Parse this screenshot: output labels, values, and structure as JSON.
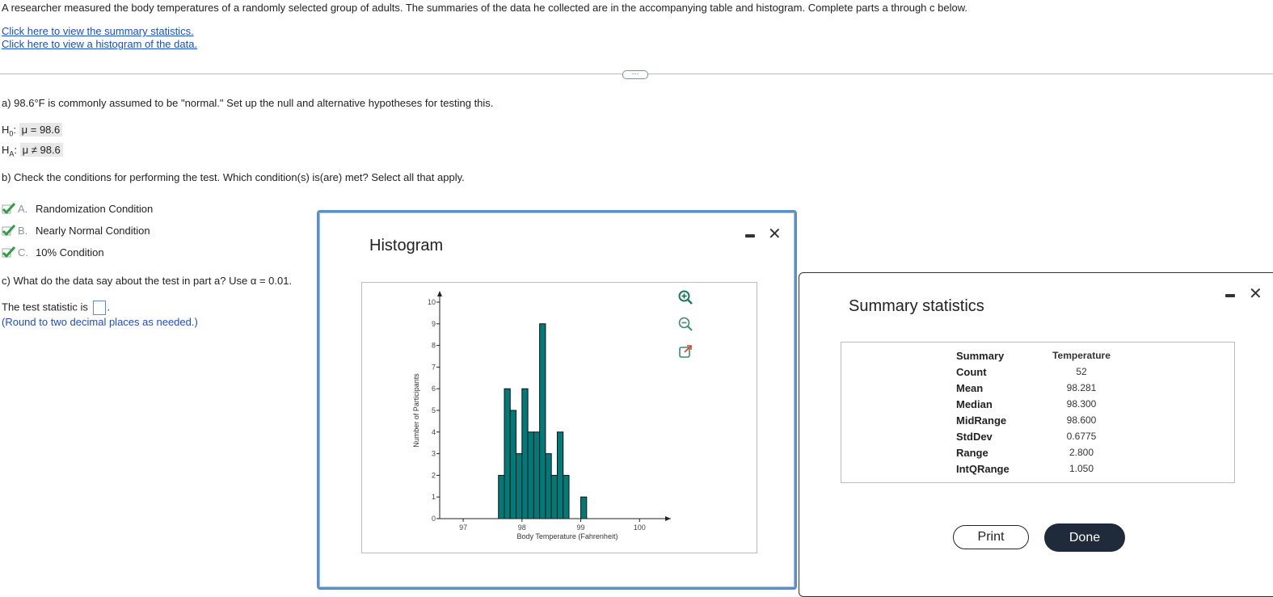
{
  "intro": "A researcher measured the body temperatures of a randomly selected group of adults. The summaries of the data he collected are in the accompanying table and histogram. Complete parts a through c below.",
  "links": {
    "summary": "Click here to view the summary statistics.",
    "histogram": "Click here to view a histogram of the data."
  },
  "ellipsis": "···",
  "part_a": {
    "prompt": "a) 98.6°F is commonly assumed to be \"normal.\" Set up the null and alternative hypotheses for testing this.",
    "h0_label": "H",
    "h0_sub": "0",
    "h0_value": "μ = 98.6",
    "ha_label": "H",
    "ha_sub": "A",
    "ha_value": "μ ≠ 98.6"
  },
  "part_b": {
    "prompt": "b) Check the conditions for performing the test. Which condition(s) is(are) met? Select all that apply.",
    "options": [
      {
        "letter": "A.",
        "label": "Randomization Condition",
        "checked": true
      },
      {
        "letter": "B.",
        "label": "Nearly Normal Condition",
        "checked": true
      },
      {
        "letter": "C.",
        "label": "10% Condition",
        "checked": true
      }
    ]
  },
  "part_c": {
    "prompt": "c) What do the data say about the test in part a? Use α = 0.01.",
    "statistic_label": "The test statistic is",
    "statistic_value": "",
    "round_note": "(Round to two decimal places as needed.)"
  },
  "histogram_window": {
    "title": "Histogram",
    "close": "✕"
  },
  "chart_data": {
    "type": "bar",
    "xlabel": "Body Temperature (Fahrenheit)",
    "ylabel": "Number of Participants",
    "xlim": [
      96.6,
      100.45
    ],
    "ylim": [
      0,
      10
    ],
    "xticks": [
      "97",
      "98",
      "99",
      "100"
    ],
    "yticks": [
      "0",
      "1",
      "2",
      "3",
      "4",
      "5",
      "6",
      "7",
      "8",
      "9",
      "10"
    ],
    "bin_width": 0.1,
    "bins": [
      {
        "start": 97.6,
        "count": 2
      },
      {
        "start": 97.7,
        "count": 6
      },
      {
        "start": 97.8,
        "count": 5
      },
      {
        "start": 97.9,
        "count": 3
      },
      {
        "start": 98.0,
        "count": 6
      },
      {
        "start": 98.1,
        "count": 4
      },
      {
        "start": 98.2,
        "count": 4
      },
      {
        "start": 98.3,
        "count": 9
      },
      {
        "start": 98.4,
        "count": 3
      },
      {
        "start": 98.5,
        "count": 2
      },
      {
        "start": 98.6,
        "count": 4
      },
      {
        "start": 98.7,
        "count": 2
      },
      {
        "start": 98.8,
        "count": 0
      },
      {
        "start": 98.9,
        "count": 0
      },
      {
        "start": 99.0,
        "count": 1
      }
    ],
    "bar_color": "#007a78"
  },
  "summary_window": {
    "title": "Summary statistics",
    "close": "✕",
    "header": {
      "label": "Summary",
      "value": "Temperature"
    },
    "rows": [
      {
        "label": "Count",
        "value": "52"
      },
      {
        "label": "Mean",
        "value": "98.281"
      },
      {
        "label": "Median",
        "value": "98.300"
      },
      {
        "label": "MidRange",
        "value": "98.600"
      },
      {
        "label": "StdDev",
        "value": "0.6775"
      },
      {
        "label": "Range",
        "value": "2.800"
      },
      {
        "label": "IntQRange",
        "value": "1.050"
      }
    ],
    "print_label": "Print",
    "done_label": "Done"
  }
}
